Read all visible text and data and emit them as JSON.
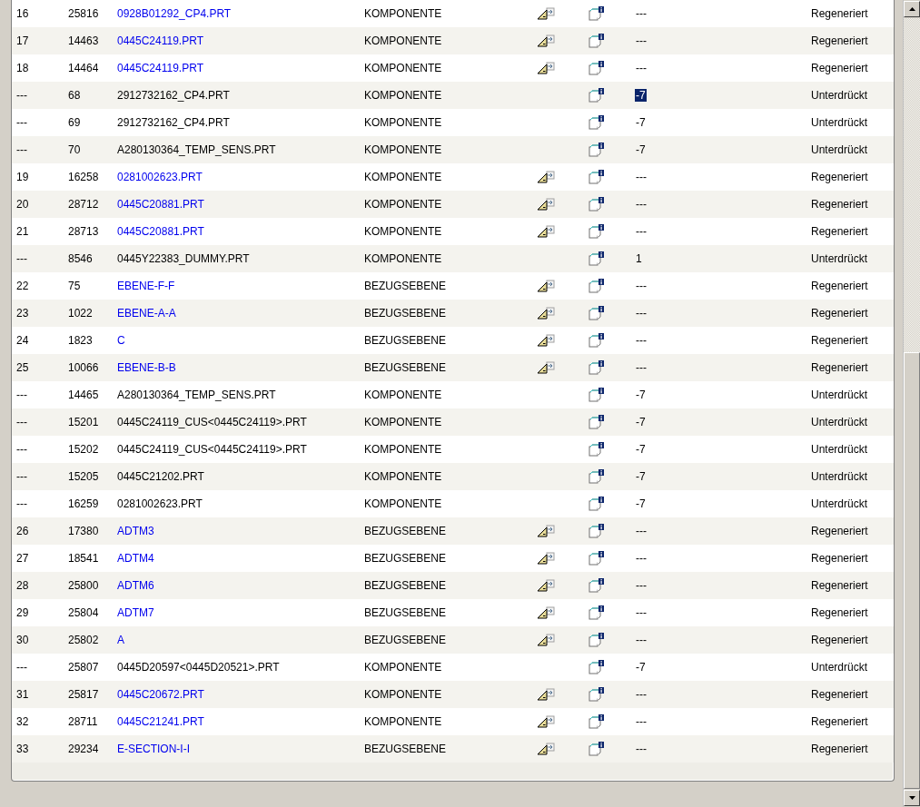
{
  "rows": [
    {
      "number": "16",
      "id": "25816",
      "name": "0928B01292_CP4.PRT",
      "linked": true,
      "type": "KOMPONENTE",
      "relation_icon": true,
      "value": "---",
      "value_selected": false,
      "status": "Regeneriert"
    },
    {
      "number": "17",
      "id": "14463",
      "name": "0445C24119.PRT",
      "linked": true,
      "type": "KOMPONENTE",
      "relation_icon": true,
      "value": "---",
      "value_selected": false,
      "status": "Regeneriert"
    },
    {
      "number": "18",
      "id": "14464",
      "name": "0445C24119.PRT",
      "linked": true,
      "type": "KOMPONENTE",
      "relation_icon": true,
      "value": "---",
      "value_selected": false,
      "status": "Regeneriert"
    },
    {
      "number": "---",
      "id": "68",
      "name": "2912732162_CP4.PRT",
      "linked": false,
      "type": "KOMPONENTE",
      "relation_icon": false,
      "value": "-7",
      "value_selected": true,
      "status": "Unterdrückt"
    },
    {
      "number": "---",
      "id": "69",
      "name": "2912732162_CP4.PRT",
      "linked": false,
      "type": "KOMPONENTE",
      "relation_icon": false,
      "value": "-7",
      "value_selected": false,
      "status": "Unterdrückt"
    },
    {
      "number": "---",
      "id": "70",
      "name": "A280130364_TEMP_SENS.PRT",
      "linked": false,
      "type": "KOMPONENTE",
      "relation_icon": false,
      "value": "-7",
      "value_selected": false,
      "status": "Unterdrückt"
    },
    {
      "number": "19",
      "id": "16258",
      "name": "0281002623.PRT",
      "linked": true,
      "type": "KOMPONENTE",
      "relation_icon": true,
      "value": "---",
      "value_selected": false,
      "status": "Regeneriert"
    },
    {
      "number": "20",
      "id": "28712",
      "name": "0445C20881.PRT",
      "linked": true,
      "type": "KOMPONENTE",
      "relation_icon": true,
      "value": "---",
      "value_selected": false,
      "status": "Regeneriert"
    },
    {
      "number": "21",
      "id": "28713",
      "name": "0445C20881.PRT",
      "linked": true,
      "type": "KOMPONENTE",
      "relation_icon": true,
      "value": "---",
      "value_selected": false,
      "status": "Regeneriert"
    },
    {
      "number": "---",
      "id": "8546",
      "name": "0445Y22383_DUMMY.PRT",
      "linked": false,
      "type": "KOMPONENTE",
      "relation_icon": false,
      "value": "1",
      "value_selected": false,
      "status": "Unterdrückt"
    },
    {
      "number": "22",
      "id": "75",
      "name": "EBENE-F-F",
      "linked": true,
      "type": "BEZUGSEBENE",
      "relation_icon": true,
      "value": "---",
      "value_selected": false,
      "status": "Regeneriert"
    },
    {
      "number": "23",
      "id": "1022",
      "name": "EBENE-A-A",
      "linked": true,
      "type": "BEZUGSEBENE",
      "relation_icon": true,
      "value": "---",
      "value_selected": false,
      "status": "Regeneriert"
    },
    {
      "number": "24",
      "id": "1823",
      "name": "C",
      "linked": true,
      "type": "BEZUGSEBENE",
      "relation_icon": true,
      "value": "---",
      "value_selected": false,
      "status": "Regeneriert"
    },
    {
      "number": "25",
      "id": "10066",
      "name": "EBENE-B-B",
      "linked": true,
      "type": "BEZUGSEBENE",
      "relation_icon": true,
      "value": "---",
      "value_selected": false,
      "status": "Regeneriert"
    },
    {
      "number": "---",
      "id": "14465",
      "name": "A280130364_TEMP_SENS.PRT",
      "linked": false,
      "type": "KOMPONENTE",
      "relation_icon": false,
      "value": "-7",
      "value_selected": false,
      "status": "Unterdrückt"
    },
    {
      "number": "---",
      "id": "15201",
      "name": "0445C24119_CUS<0445C24119>.PRT",
      "linked": false,
      "type": "KOMPONENTE",
      "relation_icon": false,
      "value": "-7",
      "value_selected": false,
      "status": "Unterdrückt"
    },
    {
      "number": "---",
      "id": "15202",
      "name": "0445C24119_CUS<0445C24119>.PRT",
      "linked": false,
      "type": "KOMPONENTE",
      "relation_icon": false,
      "value": "-7",
      "value_selected": false,
      "status": "Unterdrückt"
    },
    {
      "number": "---",
      "id": "15205",
      "name": "0445C21202.PRT",
      "linked": false,
      "type": "KOMPONENTE",
      "relation_icon": false,
      "value": "-7",
      "value_selected": false,
      "status": "Unterdrückt"
    },
    {
      "number": "---",
      "id": "16259",
      "name": "0281002623.PRT",
      "linked": false,
      "type": "KOMPONENTE",
      "relation_icon": false,
      "value": "-7",
      "value_selected": false,
      "status": "Unterdrückt"
    },
    {
      "number": "26",
      "id": "17380",
      "name": "ADTM3",
      "linked": true,
      "type": "BEZUGSEBENE",
      "relation_icon": true,
      "value": "---",
      "value_selected": false,
      "status": "Regeneriert"
    },
    {
      "number": "27",
      "id": "18541",
      "name": "ADTM4",
      "linked": true,
      "type": "BEZUGSEBENE",
      "relation_icon": true,
      "value": "---",
      "value_selected": false,
      "status": "Regeneriert"
    },
    {
      "number": "28",
      "id": "25800",
      "name": "ADTM6",
      "linked": true,
      "type": "BEZUGSEBENE",
      "relation_icon": true,
      "value": "---",
      "value_selected": false,
      "status": "Regeneriert"
    },
    {
      "number": "29",
      "id": "25804",
      "name": "ADTM7",
      "linked": true,
      "type": "BEZUGSEBENE",
      "relation_icon": true,
      "value": "---",
      "value_selected": false,
      "status": "Regeneriert"
    },
    {
      "number": "30",
      "id": "25802",
      "name": "A",
      "linked": true,
      "type": "BEZUGSEBENE",
      "relation_icon": true,
      "value": "---",
      "value_selected": false,
      "status": "Regeneriert"
    },
    {
      "number": "---",
      "id": "25807",
      "name": "0445D20597<0445D20521>.PRT",
      "linked": false,
      "type": "KOMPONENTE",
      "relation_icon": false,
      "value": "-7",
      "value_selected": false,
      "status": "Unterdrückt"
    },
    {
      "number": "31",
      "id": "25817",
      "name": "0445C20672.PRT",
      "linked": true,
      "type": "KOMPONENTE",
      "relation_icon": true,
      "value": "---",
      "value_selected": false,
      "status": "Regeneriert"
    },
    {
      "number": "32",
      "id": "28711",
      "name": "0445C21241.PRT",
      "linked": true,
      "type": "KOMPONENTE",
      "relation_icon": true,
      "value": "---",
      "value_selected": false,
      "status": "Regeneriert"
    },
    {
      "number": "33",
      "id": "29234",
      "name": "E-SECTION-I-I",
      "linked": true,
      "type": "BEZUGSEBENE",
      "relation_icon": true,
      "value": "---",
      "value_selected": false,
      "status": "Regeneriert"
    }
  ]
}
